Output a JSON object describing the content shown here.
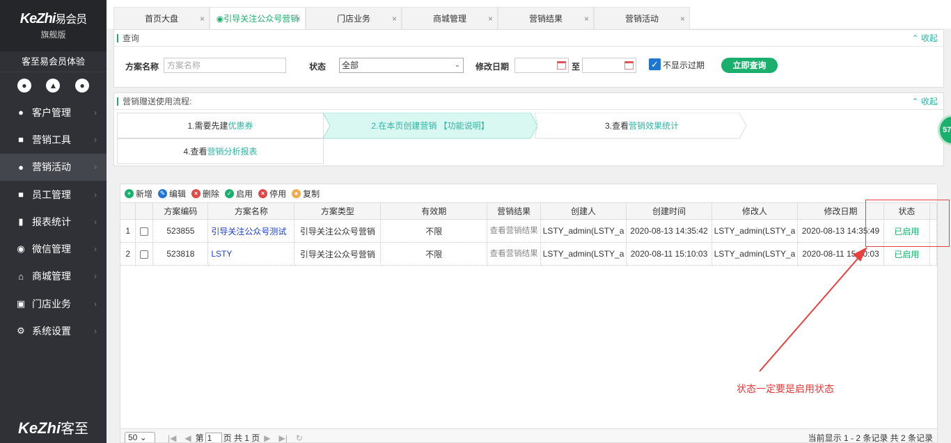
{
  "sidebar": {
    "logo_en": "KeZhi",
    "logo_cn": "易会员",
    "logo_sub": "旗舰版",
    "user": "客至易会员体验",
    "items": [
      {
        "label": "客户管理",
        "icon": "user-icon"
      },
      {
        "label": "营销工具",
        "icon": "toolbox-icon"
      },
      {
        "label": "营销活动",
        "icon": "lightbulb-icon"
      },
      {
        "label": "员工管理",
        "icon": "staff-icon"
      },
      {
        "label": "报表统计",
        "icon": "report-icon"
      },
      {
        "label": "微信管理",
        "icon": "wechat-icon"
      },
      {
        "label": "商城管理",
        "icon": "shop-icon"
      },
      {
        "label": "门店业务",
        "icon": "store-icon"
      },
      {
        "label": "系统设置",
        "icon": "gear-icon"
      }
    ],
    "bottom_logo_en": "KeZhi",
    "bottom_logo_cn": "客至"
  },
  "tabs": [
    {
      "label": "首页大盘"
    },
    {
      "label": "引导关注公众号营销"
    },
    {
      "label": "门店业务"
    },
    {
      "label": "商城管理"
    },
    {
      "label": "营销结果"
    },
    {
      "label": "营销活动"
    }
  ],
  "query": {
    "title": "查询",
    "collapse": "收起",
    "name_label": "方案名称",
    "name_placeholder": "方案名称",
    "status_label": "状态",
    "status_value": "全部",
    "date_label": "修改日期",
    "to_label": "至",
    "hide_expired_label": "不显示过期",
    "submit_label": "立即查询"
  },
  "process": {
    "title": "营销赠送使用流程:",
    "collapse": "收起",
    "step1_pre": "1.需要先建",
    "step1_link": "优惠券",
    "step2": "2.在本页创建营销 【功能说明】",
    "step3_pre": "3.查看",
    "step3_link": "营销效果统计",
    "step4_pre": "4.查看",
    "step4_link": "营销分析报表"
  },
  "toolbar": {
    "add": "新增",
    "edit": "编辑",
    "delete": "删除",
    "enable": "启用",
    "disable": "停用",
    "copy": "复制"
  },
  "table": {
    "columns": [
      "方案编码",
      "方案名称",
      "方案类型",
      "有效期",
      "营销结果",
      "创建人",
      "创建时间",
      "修改人",
      "修改日期",
      "状态"
    ],
    "rows": [
      {
        "rn": "1",
        "code": "523855",
        "name": "引导关注公众号测试",
        "type": "引导关注公众号营销",
        "validity": "不限",
        "result": "查看营销结果",
        "creator": "LSTY_admin(LSTY_a",
        "created": "2020-08-13 14:35:42",
        "modifier": "LSTY_admin(LSTY_a",
        "modified": "2020-08-13 14:35:49",
        "status": "已启用"
      },
      {
        "rn": "2",
        "code": "523818",
        "name": "LSTY",
        "type": "引导关注公众号营销",
        "validity": "不限",
        "result": "查看营销结果",
        "creator": "LSTY_admin(LSTY_a",
        "created": "2020-08-11 15:10:03",
        "modifier": "LSTY_admin(LSTY_a",
        "modified": "2020-08-11 15:10:03",
        "status": "已启用"
      }
    ]
  },
  "pager": {
    "page_size": "50",
    "page_prefix": "第",
    "page_value": "1",
    "page_suffix": "页 共 1 页",
    "summary": "当前显示 1 - 2 条记录 共 2 条记录"
  },
  "annotation": {
    "text": "状态一定要是启用状态"
  },
  "badge": {
    "text": "57"
  },
  "colors": {
    "accent": "#1aaf6c",
    "sidebar": "#2f3136",
    "annotation": "#e83a3a",
    "link": "#1a3fd6"
  }
}
